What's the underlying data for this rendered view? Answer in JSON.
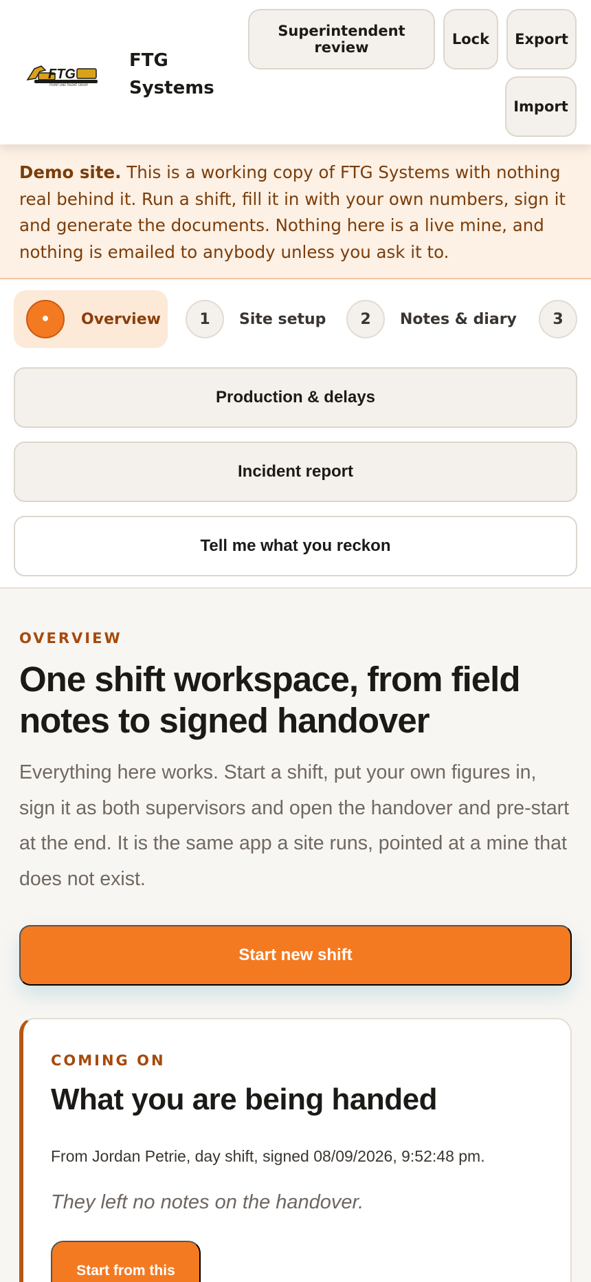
{
  "header": {
    "logo_text": "FTG",
    "logo_tagline": "FRONT LINE TALENT GROUP",
    "brand": "FTG Systems",
    "buttons": {
      "superintendent_review": "Superintendent review",
      "lock": "Lock",
      "export": "Export",
      "import": "Import"
    }
  },
  "banner": {
    "bold": "Demo site.",
    "text": "This is a working copy of FTG Systems with nothing real behind it. Run a shift, fill it in with your own numbers, sign it and generate the documents. Nothing here is a live mine, and nothing is emailed to anybody unless you ask it to."
  },
  "steps": [
    {
      "num": "•",
      "label": "Overview",
      "active": true
    },
    {
      "num": "1",
      "label": "Site setup"
    },
    {
      "num": "2",
      "label": "Notes & diary"
    },
    {
      "num": "3",
      "label": ""
    }
  ],
  "nav_pills": {
    "production": "Production & delays",
    "incident": "Incident report",
    "feedback": "Tell me what you reckon"
  },
  "main": {
    "eyebrow": "OVERVIEW",
    "title": "One shift workspace, from field notes to signed handover",
    "lead": "Everything here works. Start a shift, put your own figures in, sign it as both supervisors and open the handover and pre-start at the end. It is the same app a site runs, pointed at a mine that does not exist.",
    "cta": "Start new shift"
  },
  "handover_card": {
    "eyebrow": "COMING ON",
    "title": "What you are being handed",
    "meta": "From Jordan Petrie, day shift, signed 08/09/2026, 9:52:48 pm.",
    "note": "They left no notes on the handover.",
    "button": "Start from this"
  },
  "colors": {
    "accent": "#f47a22",
    "accent_dark": "#a54a0c",
    "banner_bg": "#fdf0e4"
  }
}
